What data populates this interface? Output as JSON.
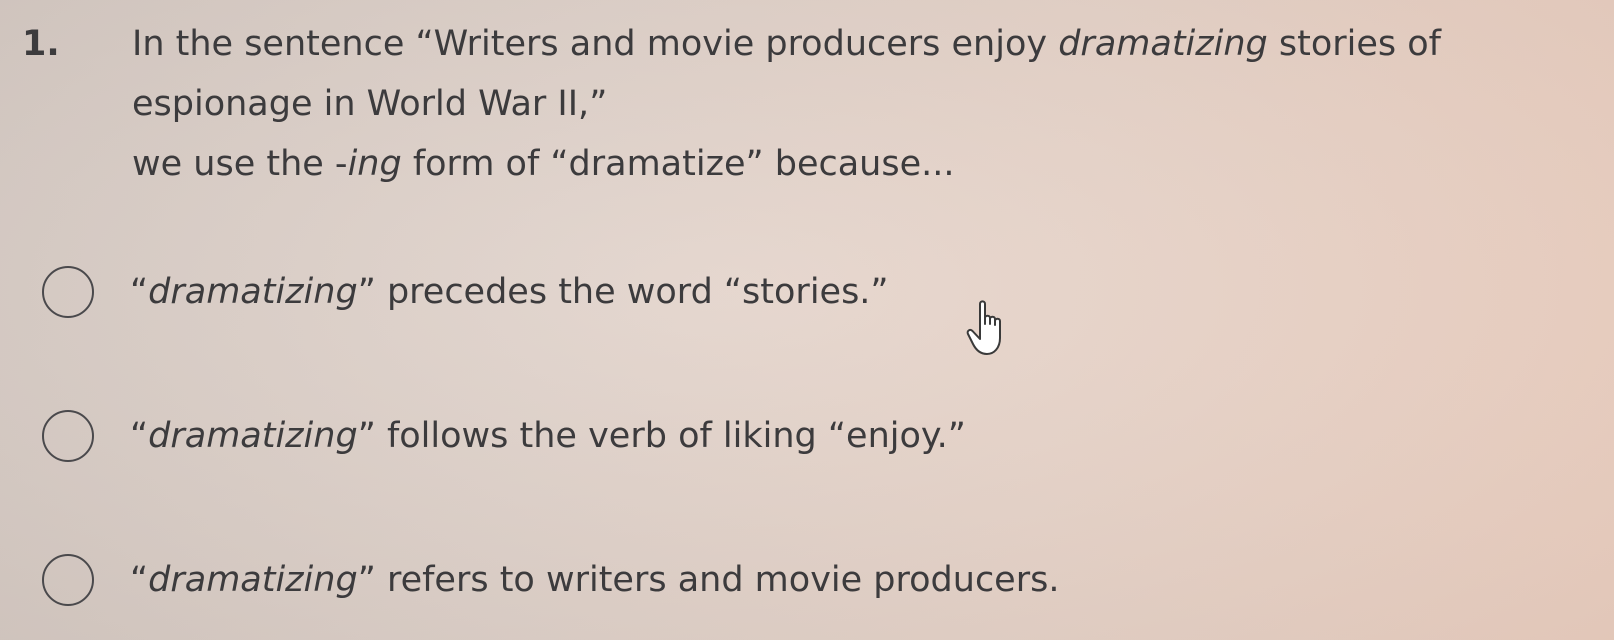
{
  "question": {
    "number": "1.",
    "line1_pre": "In the sentence “Writers and movie producers enjoy ",
    "line1_italic": "dramatizing",
    "line1_post": " stories of",
    "line2": "espionage in World War II,”",
    "line3_pre": "we use the -",
    "line3_italic": "ing",
    "line3_post": " form of “dramatize” because..."
  },
  "options": [
    {
      "open_quote": "“",
      "italic": "dramatizing",
      "rest": "” precedes the word “stories.”"
    },
    {
      "open_quote": "“",
      "italic": "dramatizing",
      "rest": "” follows the verb of liking “enjoy.”"
    },
    {
      "open_quote": "“",
      "italic": "dramatizing",
      "rest": "” refers to writers and movie producers."
    }
  ],
  "cursor_icon": "hand-pointer-icon"
}
